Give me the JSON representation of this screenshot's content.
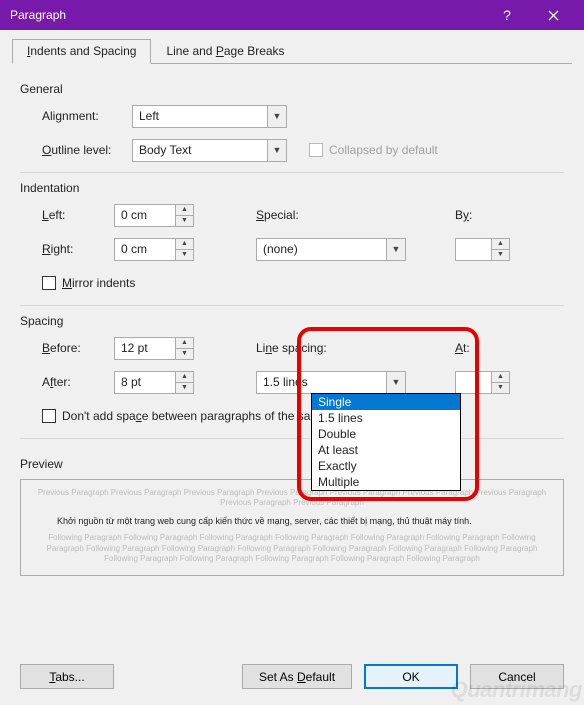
{
  "title": "Paragraph",
  "tabs": {
    "spacing": "Indents and Spacing",
    "breaks": "Line and Page Breaks"
  },
  "general": {
    "heading": "General",
    "alignment_label": "Alignment:",
    "alignment_value": "Left",
    "outline_label": "Outline level:",
    "outline_value": "Body Text",
    "collapsed_label": "Collapsed by default"
  },
  "indent": {
    "heading": "Indentation",
    "left_label": "Left:",
    "left_value": "0 cm",
    "right_label": "Right:",
    "right_value": "0 cm",
    "special_label": "Special:",
    "special_value": "(none)",
    "by_label": "By:",
    "by_value": "",
    "mirror_label": "Mirror indents"
  },
  "spacing": {
    "heading": "Spacing",
    "before_label": "Before:",
    "before_value": "12 pt",
    "after_label": "After:",
    "after_value": "8 pt",
    "line_label": "Line spacing:",
    "line_value": "1.5 lines",
    "at_label": "At:",
    "at_value": "",
    "dontadd_label": "Don't add space between paragraphs of the same style",
    "options": {
      "o0": "Single",
      "o1": "1.5 lines",
      "o2": "Double",
      "o3": "At least",
      "o4": "Exactly",
      "o5": "Multiple"
    }
  },
  "preview": {
    "heading": "Preview",
    "ghost_prev": "Previous Paragraph Previous Paragraph Previous Paragraph Previous Paragraph Previous Paragraph Previous Paragraph Previous Paragraph Previous Paragraph Previous Paragraph",
    "main": "Khởi nguồn từ một trang web cung cấp kiến thức về mạng, server, các thiết bị mạng, thủ thuật máy tính.",
    "ghost_next": "Following Paragraph Following Paragraph Following Paragraph Following Paragraph Following Paragraph Following Paragraph Following Paragraph Following Paragraph Following Paragraph Following Paragraph Following Paragraph Following Paragraph Following Paragraph Following Paragraph Following Paragraph Following Paragraph Following Paragraph Following Paragraph"
  },
  "buttons": {
    "tabs": "Tabs...",
    "default": "Set As Default",
    "ok": "OK",
    "cancel": "Cancel"
  },
  "watermark": "Quantrimang"
}
